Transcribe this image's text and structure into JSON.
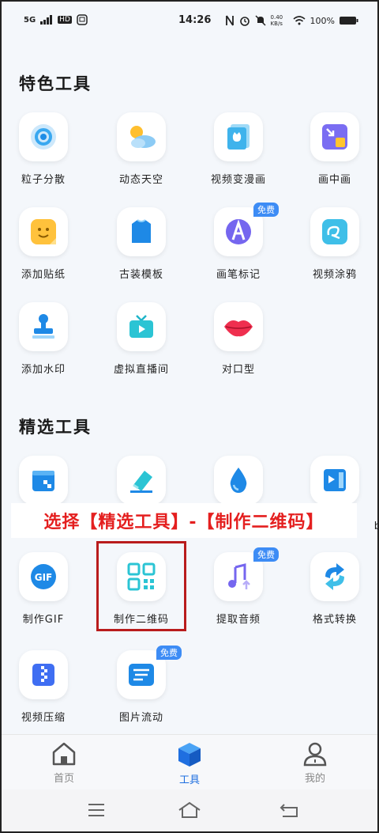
{
  "status_bar": {
    "signal": "5G",
    "hd": "HD",
    "time": "14:26",
    "speed": "0.40 KB/s",
    "battery": "100%"
  },
  "sections": {
    "featured_title": "特色工具",
    "selected_title": "精选工具"
  },
  "featured_tools": [
    {
      "label": "粒子分散"
    },
    {
      "label": "动态天空"
    },
    {
      "label": "视频变漫画"
    },
    {
      "label": "画中画"
    },
    {
      "label": "添加贴纸"
    },
    {
      "label": "古装模板"
    },
    {
      "label": "画笔标记",
      "badge": "免费"
    },
    {
      "label": "视频涂鸦"
    },
    {
      "label": "添加水印"
    },
    {
      "label": "虚拟直播间"
    },
    {
      "label": "对口型"
    }
  ],
  "selected_tools": [
    {
      "label": "制作GIF"
    },
    {
      "label": "制作二维码"
    },
    {
      "label": "提取音频",
      "badge": "免费"
    },
    {
      "label": "格式转换"
    },
    {
      "label": "视频压缩"
    },
    {
      "label": "图片流动",
      "badge": "免费"
    }
  ],
  "annotation": {
    "text": "选择【精选工具】-【制作二维码】",
    "partial_char": "b"
  },
  "bottom_nav": {
    "home": "首页",
    "tools": "工具",
    "mine": "我的"
  },
  "colors": {
    "accent": "#1f6fe0",
    "badge": "#3d8cf5",
    "annotation_text": "#e41f1f",
    "highlight_border": "#b91c1c"
  }
}
